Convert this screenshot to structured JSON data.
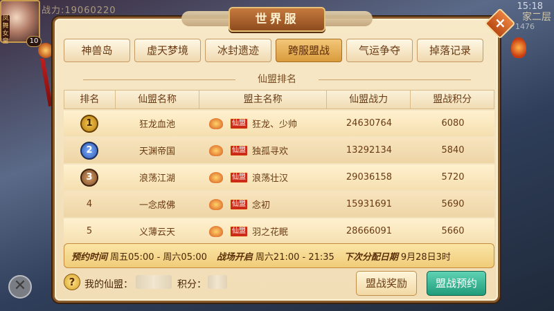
{
  "hud": {
    "avatar_tag": "凤舞女皇",
    "level": "10",
    "power_text": "战力:19060220",
    "time": "15:18",
    "floor": "家二层",
    "floor_num": "1476"
  },
  "window": {
    "title": "世界服",
    "close_label": "×"
  },
  "tabs": [
    {
      "label": "神兽岛",
      "active": false
    },
    {
      "label": "虚天梦境",
      "active": false
    },
    {
      "label": "冰封遗迹",
      "active": false
    },
    {
      "label": "跨服盟战",
      "active": true
    },
    {
      "label": "气运争夺",
      "active": false
    },
    {
      "label": "掉落记录",
      "active": false
    }
  ],
  "section_title": "仙盟排名",
  "table": {
    "headers": [
      "排名",
      "仙盟名称",
      "盟主名称",
      "仙盟战力",
      "盟战积分"
    ],
    "leader_tag": "仙盟",
    "rows": [
      {
        "rank": "1",
        "guild": "狂龙血池",
        "leader": "狂龙、少帅",
        "power": "24630764",
        "score": "6080"
      },
      {
        "rank": "2",
        "guild": "天渊帝国",
        "leader": "独孤寻欢",
        "power": "13292134",
        "score": "5840"
      },
      {
        "rank": "3",
        "guild": "浪荡江湖",
        "leader": "浪荡壮汉",
        "power": "29036158",
        "score": "5720"
      },
      {
        "rank": "4",
        "guild": "一念成佛",
        "leader": "念初",
        "power": "15931691",
        "score": "5690"
      },
      {
        "rank": "5",
        "guild": "义薄云天",
        "leader": "羽之花眠",
        "power": "28666091",
        "score": "5660"
      }
    ]
  },
  "info": {
    "reserve_label": "预约时间",
    "reserve_value": "周五05:00 - 周六05:00",
    "battle_label": "战场开启",
    "battle_value": "周六21:00 - 21:35",
    "next_label": "下次分配日期",
    "next_value": "9月28日3时"
  },
  "footer": {
    "help_icon": "?",
    "my_guild_label": "我的仙盟：",
    "score_label": "积分：",
    "reward_button": "盟战奖励",
    "reserve_button": "盟战预约"
  },
  "colors": {
    "panel_bg": "#f3e1bb",
    "accent_green": "#1f9c7a",
    "tab_active": "#d99b3c"
  }
}
